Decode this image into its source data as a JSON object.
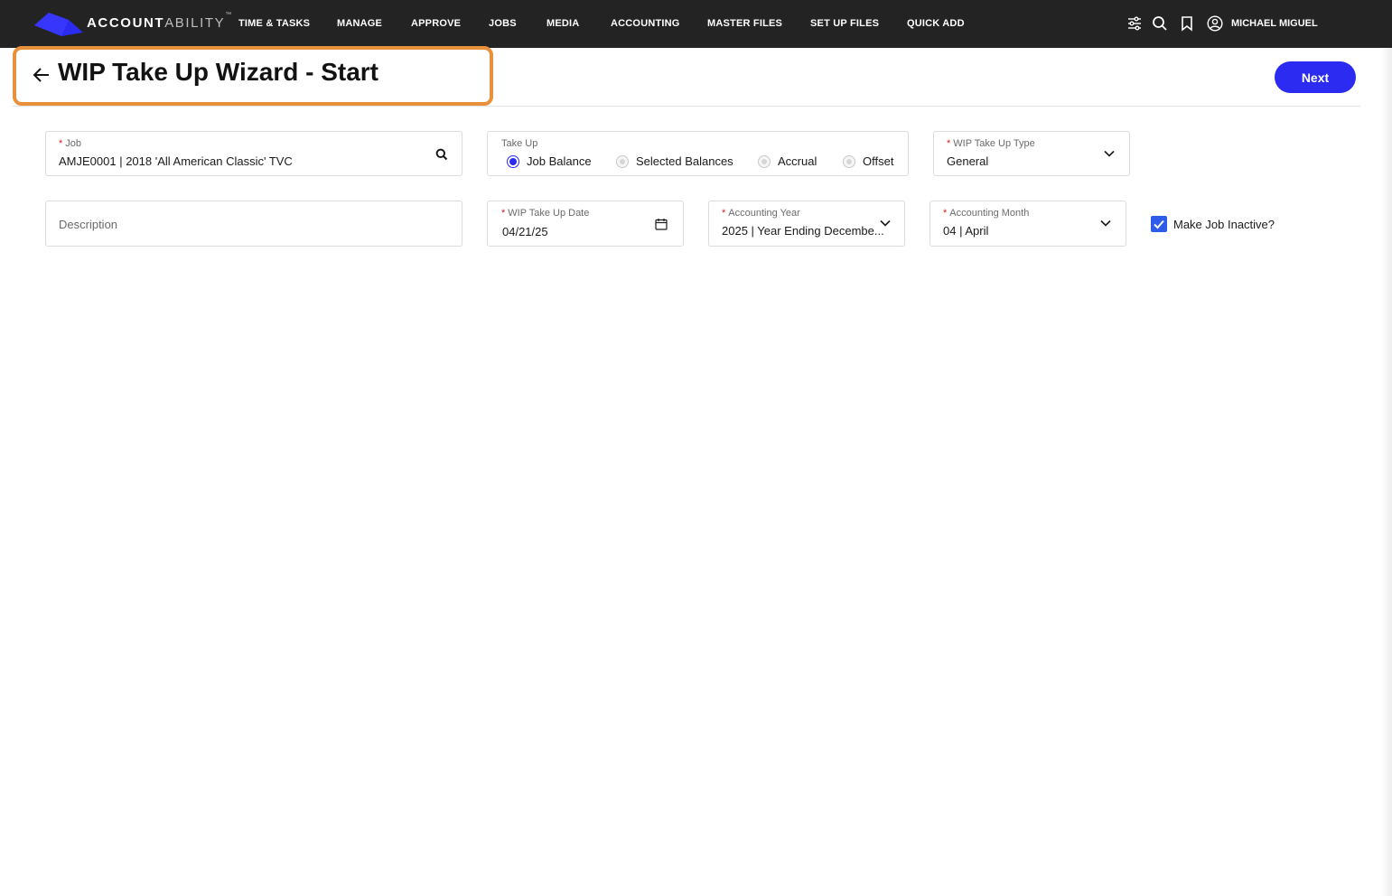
{
  "brand": {
    "name_bold": "ACCOUNT",
    "name_light": "ABILITY",
    "tm": "™",
    "logo_color": "#2b2bf2"
  },
  "nav": [
    {
      "label": "TIME & TASKS"
    },
    {
      "label": "MANAGE"
    },
    {
      "label": "APPROVE"
    },
    {
      "label": "JOBS"
    },
    {
      "label": "MEDIA"
    },
    {
      "label": "ACCOUNTING"
    },
    {
      "label": "MASTER FILES"
    },
    {
      "label": "SET UP FILES"
    },
    {
      "label": "QUICK ADD"
    }
  ],
  "header_icons": [
    "filter-sliders-icon",
    "search-icon",
    "bookmark-icon",
    "user-avatar-icon"
  ],
  "user": {
    "name": "MICHAEL MIGUEL"
  },
  "page": {
    "title": "WIP Take Up Wizard - Start",
    "next_label": "Next",
    "highlight_color": "#e9913a",
    "accent_color": "#2b2bf2"
  },
  "form": {
    "job": {
      "required": "*",
      "label": "Job",
      "value": "AMJE0001 | 2018 'All American Classic' TVC"
    },
    "take_up": {
      "label": "Take Up",
      "options": [
        {
          "label": "Job Balance",
          "selected": true
        },
        {
          "label": "Selected Balances",
          "selected": false
        },
        {
          "label": "Accrual",
          "selected": false
        },
        {
          "label": "Offset",
          "selected": false
        }
      ]
    },
    "wip_type": {
      "required": "*",
      "label": "WIP Take Up Type",
      "value": "General"
    },
    "description": {
      "placeholder": "Description"
    },
    "wip_date": {
      "required": "*",
      "label": "WIP Take Up Date",
      "value": "04/21/25"
    },
    "acct_year": {
      "required": "*",
      "label": "Accounting Year",
      "value": "2025 | Year Ending Decembe..."
    },
    "acct_month": {
      "required": "*",
      "label": "Accounting Month",
      "value": "04 | April"
    },
    "inactive": {
      "label": "Make Job Inactive?",
      "checked": true
    }
  }
}
